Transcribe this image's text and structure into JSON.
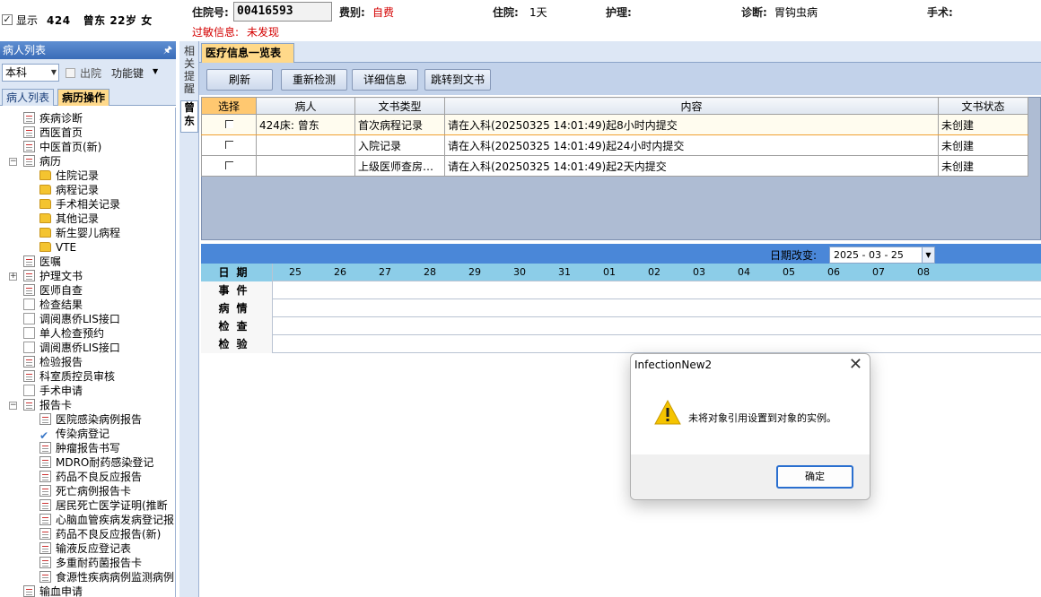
{
  "header": {
    "show_label": "显示",
    "bed": "424",
    "name": "曾东",
    "age": "22岁",
    "sex": "女",
    "admission_no_label": "住院号:",
    "admission_no": "00416593",
    "fee_type_label": "费别:",
    "fee_type": "自费",
    "stay_label": "住院:",
    "stay": "1天",
    "nursing_label": "护理:",
    "nursing": "",
    "diagnosis_label": "诊断:",
    "diagnosis": "胃钩虫病",
    "surgery_label": "手术:",
    "surgery": "",
    "allergy_label": "过敏信息:",
    "allergy": "未发现"
  },
  "left_panel": {
    "title": "病人列表",
    "pin_icon": "pin-icon",
    "dept": "本科",
    "discharged_label": "出院",
    "function_key_label": "功能键",
    "tabs": [
      "病人列表",
      "病历操作"
    ],
    "tree": [
      "疾病诊断",
      "西医首页",
      "中医首页(新)",
      "病历",
      "住院记录",
      "病程记录",
      "手术相关记录",
      "其他记录",
      "新生婴儿病程",
      "VTE",
      "医嘱",
      "护理文书",
      "医师自查",
      "检查结果",
      "调阅惠侨LIS接口",
      "单人检查预约",
      "调阅惠侨LIS接口",
      "检验报告",
      "科室质控员审核",
      "手术申请",
      "报告卡",
      "医院感染病例报告",
      "传染病登记",
      "肿瘤报告书写",
      "MDRO耐药感染登记",
      "药品不良反应报告",
      "死亡病例报告卡",
      "居民死亡医学证明(推断",
      "心脑血管疾病发病登记报",
      "药品不良反应报告(新)",
      "输液反应登记表",
      "多重耐药菌报告卡",
      "食源性疾病病例监测病例",
      "输血申请"
    ]
  },
  "side_tabs": {
    "related_reminder": "相关提醒",
    "patient": "曾东"
  },
  "main": {
    "tab_title": "医疗信息一览表",
    "buttons": {
      "refresh": "刷新",
      "recheck": "重新检测",
      "detail": "详细信息",
      "jump": "跳转到文书"
    },
    "grid": {
      "headers": {
        "select": "选择",
        "patient": "病人",
        "doc_type": "文书类型",
        "content": "内容",
        "status": "文书状态"
      },
      "rows": [
        {
          "patient": "424床: 曾东",
          "doc_type": "首次病程记录",
          "content": "请在入科(20250325 14:01:49)起8小时内提交",
          "status": "未创建"
        },
        {
          "patient": "",
          "doc_type": "入院记录",
          "content": "请在入科(20250325 14:01:49)起24小时内提交",
          "status": "未创建"
        },
        {
          "patient": "",
          "doc_type": "上级医师查房…",
          "content": "请在入科(20250325 14:01:49)起2天内提交",
          "status": "未创建"
        }
      ]
    },
    "timeline": {
      "date_change_label": "日期改变:",
      "date_value": "2025 - 03 - 25",
      "rows": {
        "date": "日期",
        "event": "事件",
        "condition": "病情",
        "exam": "检查",
        "lab": "检验"
      },
      "days": [
        "25",
        "26",
        "27",
        "28",
        "29",
        "30",
        "31",
        "01",
        "02",
        "03",
        "04",
        "05",
        "06",
        "07",
        "08"
      ]
    }
  },
  "dialog": {
    "title": "InfectionNew2",
    "message": "未将对象引用设置到对象的实例。",
    "ok": "确定",
    "icon": "warning-icon"
  }
}
